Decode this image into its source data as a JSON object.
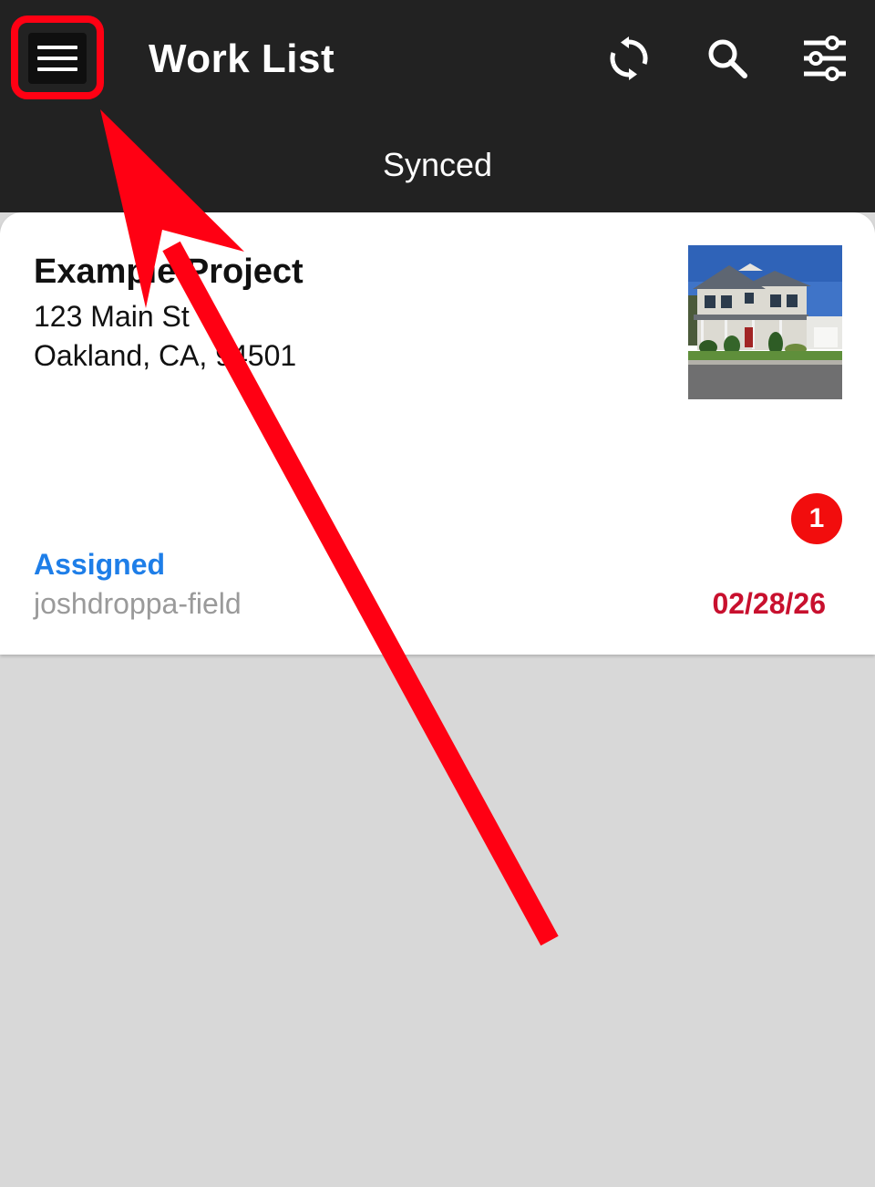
{
  "header": {
    "title": "Work List",
    "sync_status": "Synced",
    "icons": [
      "menu-icon",
      "sync-icon",
      "search-icon",
      "filter-sliders-icon"
    ]
  },
  "work_items": [
    {
      "project_name": "Example Project",
      "address_line1": "123 Main St",
      "address_line2": "Oakland, CA, 94501",
      "status": "Assigned",
      "assignee": "joshdroppa-field",
      "due_date": "02/28/26",
      "notification_count": "1"
    }
  ],
  "colors": {
    "appbar": "#222222",
    "background": "#d8d8d8",
    "status_assigned": "#1e7ee8",
    "due_date": "#c8102e",
    "badge": "#f20d0d",
    "annotation": "#ff0013"
  }
}
